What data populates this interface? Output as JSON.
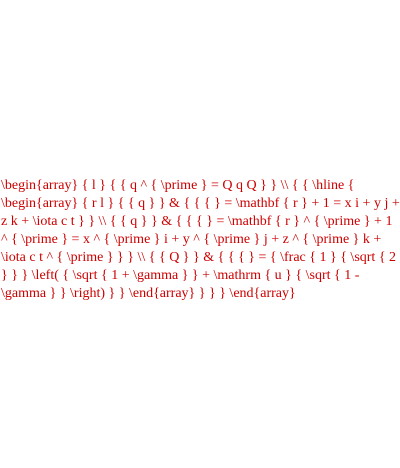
{
  "content": {
    "text": "\\begin{array} { l } { { q ^ { \\prime } = Q q Q } } \\\\ { { \\hline { \\begin{array} { r l } { { q } } & { { { } = \\mathbf { r } + 1 = x i + y j + z k + \\iota c t } } \\\\ { { q } } & { { { } = \\mathbf { r } ^ { \\prime } + 1 ^ { \\prime } = x ^ { \\prime } i + y ^ { \\prime } j + z ^ { \\prime } k + \\iota c t ^ { \\prime } } } \\\\ { { Q } } & { { { } = { \\frac { 1 } { \\sqrt { 2 } } } \\left( { \\sqrt { 1 + \\gamma } } + \\mathrm { u } { \\sqrt { 1 - \\gamma } } \\right) } } \\end{array} } } } \\end{array}",
    "color": "#cc0000"
  }
}
